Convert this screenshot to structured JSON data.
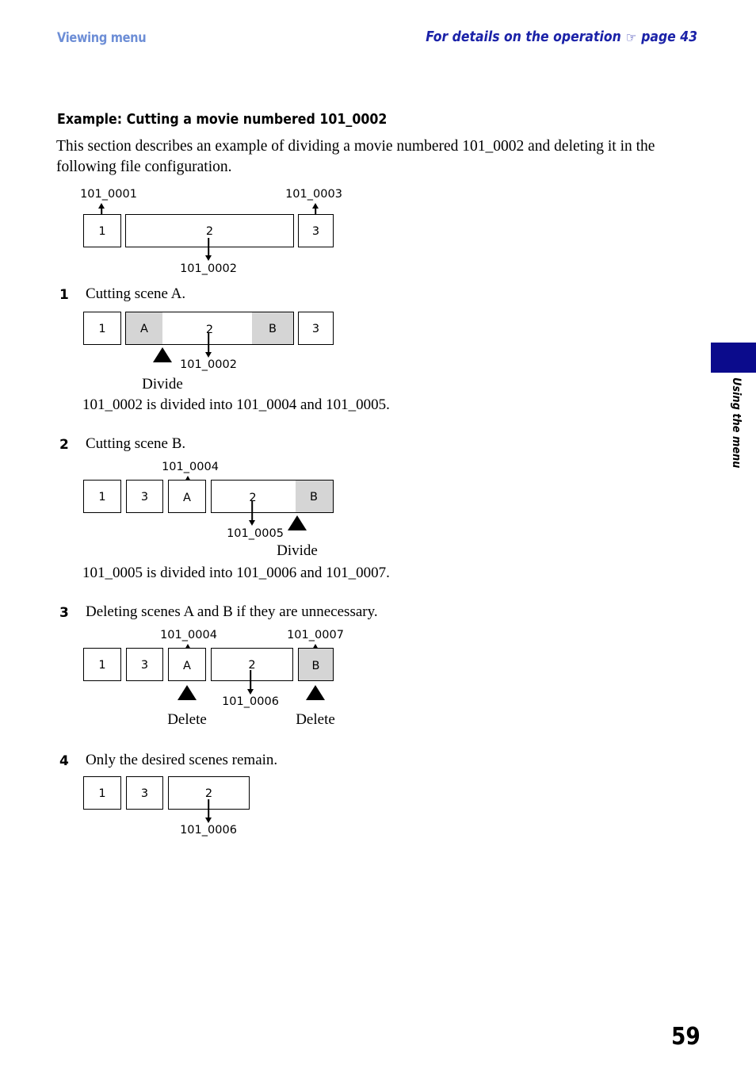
{
  "header": {
    "left_title": "Viewing menu",
    "right_title_prefix": "For details on the operation",
    "hand_icon": "☞",
    "right_title_suffix": "page 43",
    "left_color": "#6d8ed6",
    "right_color": "#1b22a8"
  },
  "side_tab": {
    "label": "Using the menu",
    "color": "#0b0b8c"
  },
  "page_number": "59",
  "section": {
    "title": "Example: Cutting a movie numbered 101_0002",
    "intro": "This section describes an example of dividing a movie numbered 101_0002 and deleting it in the following file configuration."
  },
  "steps": [
    {
      "number": "1",
      "text": "Cutting scene A."
    },
    {
      "number": "2",
      "text": "Cutting scene B."
    },
    {
      "number": "3",
      "text": "Deleting scenes A and B if they are unnecessary."
    },
    {
      "number": "4",
      "text": "Only the desired scenes remain."
    }
  ],
  "notes": [
    "101_0002 is divided into 101_0004 and 101_0005.",
    "101_0005 is divided into 101_0006 and 101_0007."
  ],
  "diagrams": [
    {
      "id": "initial-configuration",
      "boxes": [
        {
          "label": "1",
          "shaded": false
        },
        {
          "label": "2",
          "shaded": false
        },
        {
          "label": "3",
          "shaded": false
        }
      ],
      "callouts": [
        {
          "text": "101_0001",
          "direction": "up"
        },
        {
          "text": "101_0003",
          "direction": "up"
        },
        {
          "text": "101_0002",
          "direction": "down"
        }
      ],
      "markers": []
    },
    {
      "id": "cutting-scene-a",
      "boxes": [
        {
          "label": "1",
          "shaded": false
        },
        {
          "label": "2",
          "shaded": false
        },
        {
          "label": "A",
          "shaded": true
        },
        {
          "label": "B",
          "shaded": true
        },
        {
          "label": "3",
          "shaded": false
        }
      ],
      "callouts": [
        {
          "text": "101_0002",
          "direction": "down"
        }
      ],
      "markers": [
        {
          "caption": "Divide"
        }
      ]
    },
    {
      "id": "cutting-scene-b",
      "boxes": [
        {
          "label": "1",
          "shaded": false
        },
        {
          "label": "3",
          "shaded": false
        },
        {
          "label": "A",
          "shaded": false
        },
        {
          "label": "2",
          "shaded": false
        },
        {
          "label": "B",
          "shaded": true
        }
      ],
      "callouts": [
        {
          "text": "101_0004",
          "direction": "up"
        },
        {
          "text": "101_0005",
          "direction": "down"
        }
      ],
      "markers": [
        {
          "caption": "Divide"
        }
      ]
    },
    {
      "id": "deleting-scenes",
      "boxes": [
        {
          "label": "1",
          "shaded": false
        },
        {
          "label": "3",
          "shaded": false
        },
        {
          "label": "A",
          "shaded": false
        },
        {
          "label": "2",
          "shaded": false
        },
        {
          "label": "B",
          "shaded": true
        }
      ],
      "callouts": [
        {
          "text": "101_0004",
          "direction": "up"
        },
        {
          "text": "101_0007",
          "direction": "up"
        },
        {
          "text": "101_0006",
          "direction": "down"
        }
      ],
      "markers": [
        {
          "caption": "Delete"
        },
        {
          "caption": "Delete"
        }
      ]
    },
    {
      "id": "final-configuration",
      "boxes": [
        {
          "label": "1",
          "shaded": false
        },
        {
          "label": "3",
          "shaded": false
        },
        {
          "label": "2",
          "shaded": false
        }
      ],
      "callouts": [
        {
          "text": "101_0006",
          "direction": "down"
        }
      ],
      "markers": []
    }
  ]
}
